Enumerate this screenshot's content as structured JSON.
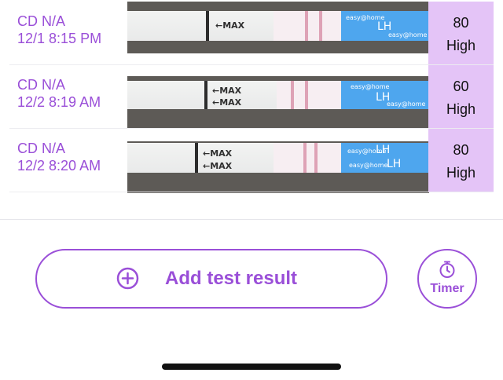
{
  "results": [
    {
      "cycle_day": "CD N/A",
      "datetime": "12/1 8:15 PM",
      "strip_marks": [
        "←MAX"
      ],
      "strip_brand": [
        "easy@home",
        "LH"
      ],
      "value": "80",
      "level": "High"
    },
    {
      "cycle_day": "CD N/A",
      "datetime": "12/2 8:19 AM",
      "strip_marks": [
        "←MAX",
        "←MAX"
      ],
      "strip_brand": [
        "easy@home",
        "LH"
      ],
      "value": "60",
      "level": "High"
    },
    {
      "cycle_day": "CD N/A",
      "datetime": "12/2 8:20 AM",
      "strip_marks": [
        "←MAX",
        "←MAX"
      ],
      "strip_brand": [
        "easy@home",
        "LH"
      ],
      "value": "80",
      "level": "High"
    }
  ],
  "actions": {
    "add_label": "Add test result",
    "add_icon": "plus-circle-icon",
    "timer_label": "Timer",
    "timer_icon": "stopwatch-icon"
  },
  "colors": {
    "accent": "#9a4fd8",
    "result_bg": "#e4c4f7",
    "strip_blue": "#4ea6ee"
  }
}
